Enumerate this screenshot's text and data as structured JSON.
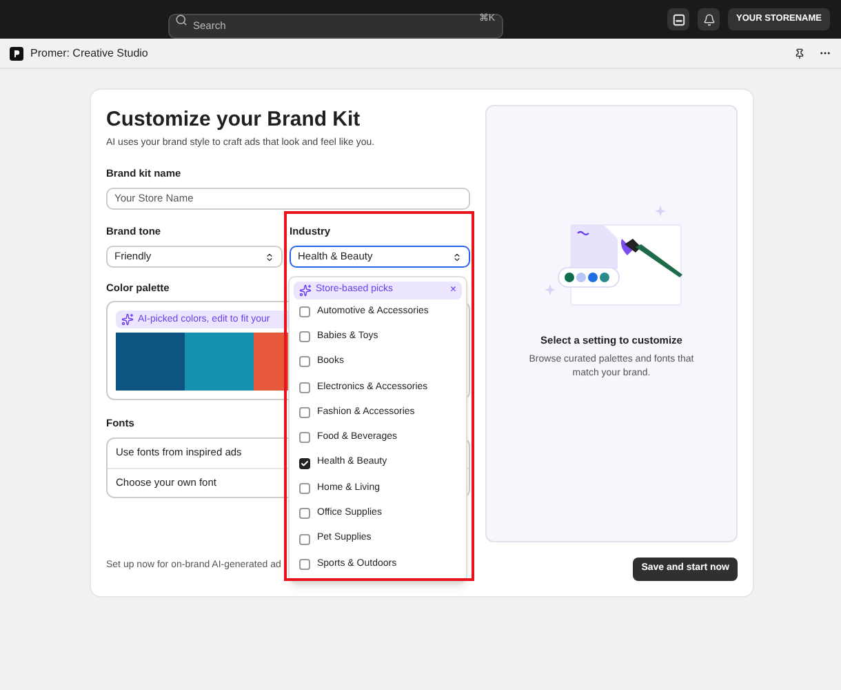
{
  "top_bar": {
    "search": {
      "placeholder": "Search",
      "shortcut": "⌘K"
    },
    "account": "YOUR STORENAME"
  },
  "app_bar": {
    "title": "Promer: Creative Studio"
  },
  "form": {
    "title": "Customize your Brand Kit",
    "subtitle": "AI uses your brand style to craft ads that look and feel like you.",
    "brand_kit_name": {
      "label": "Brand kit name",
      "placeholder": "Your Store Name"
    },
    "brand_tone": {
      "label": "Brand tone",
      "value": "Friendly"
    },
    "industry": {
      "label": "Industry",
      "value": "Health & Beauty",
      "expanded": true
    },
    "color_palette": {
      "label": "Color palette",
      "hint": "AI-picked colors, edit to fit your",
      "swatches": [
        {
          "color": "#0b5580"
        },
        {
          "color": "#1590b0"
        },
        {
          "color": "#e85a3c"
        }
      ]
    },
    "fonts": {
      "label": "Fonts",
      "options": [
        "Use fonts from inspired ads",
        "Choose your own font"
      ]
    },
    "footer_note": "Set up now for on-brand AI-generated ad"
  },
  "industry_menu": {
    "header": "Store-based picks",
    "close": "×",
    "options": [
      {
        "label": "Automotive & Accessories",
        "checked": false
      },
      {
        "label": "Babies & Toys",
        "checked": false
      },
      {
        "label": "Books",
        "checked": false
      },
      {
        "label": "Electronics & Accessories",
        "checked": false
      },
      {
        "label": "Fashion & Accessories",
        "checked": false
      },
      {
        "label": "Food & Beverages",
        "checked": false
      },
      {
        "label": "Health & Beauty",
        "checked": true
      },
      {
        "label": "Home & Living",
        "checked": false
      },
      {
        "label": "Office Supplies",
        "checked": false
      },
      {
        "label": "Pet Supplies",
        "checked": false
      },
      {
        "label": "Sports & Outdoors",
        "checked": false
      }
    ]
  },
  "preview": {
    "title": "Select a setting to customize",
    "text": "Browse curated palettes and fonts that match your brand."
  },
  "save_button": "Save and start now"
}
